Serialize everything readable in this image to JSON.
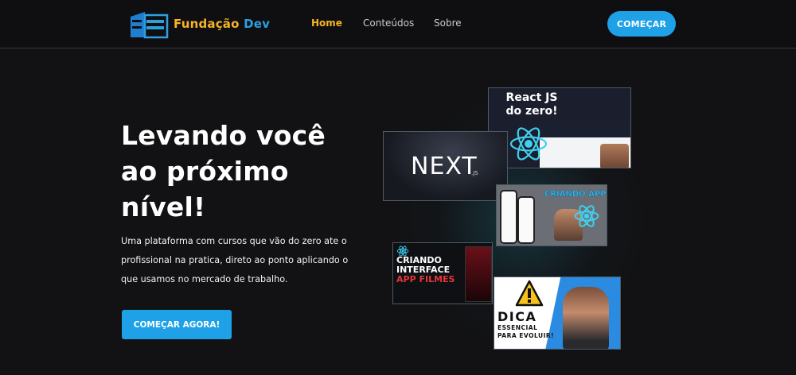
{
  "header": {
    "logo_text_part1": "Fundação",
    "logo_text_part2": "Dev",
    "nav": [
      {
        "label": "Home",
        "active": true
      },
      {
        "label": "Conteúdos",
        "active": false
      },
      {
        "label": "Sobre",
        "active": false
      }
    ],
    "cta_label": "COMEÇAR"
  },
  "hero": {
    "title_line1": "Levando você",
    "title_line2": "ao próximo",
    "title_line3": "nível!",
    "description": "Uma plataforma com cursos que vão do zero ate o profissional na pratica, direto ao ponto aplicando o que usamos no mercado de trabalho.",
    "cta_label": "COMEÇAR AGORA!"
  },
  "thumbnails": {
    "react_title_line1": "React JS",
    "react_title_line2": "do zero!",
    "next_title": "NEXT",
    "next_suffix": ".JS",
    "app_title": "CRIANDO APP",
    "filmes_line1": "CRIANDO",
    "filmes_line2": "INTERFACE",
    "filmes_line3": "APP FILMES",
    "dica_title": "DICA",
    "dica_sub_line1": "ESSENCIAL",
    "dica_sub_line2": "PARA EVOLUIR!"
  },
  "colors": {
    "background": "#121214",
    "accent_blue": "#1ea1e6",
    "accent_yellow": "#f6b426"
  },
  "icons": {
    "logo": "house-blocks-icon",
    "react": "react-atom-icon",
    "warning": "warning-triangle-icon"
  }
}
